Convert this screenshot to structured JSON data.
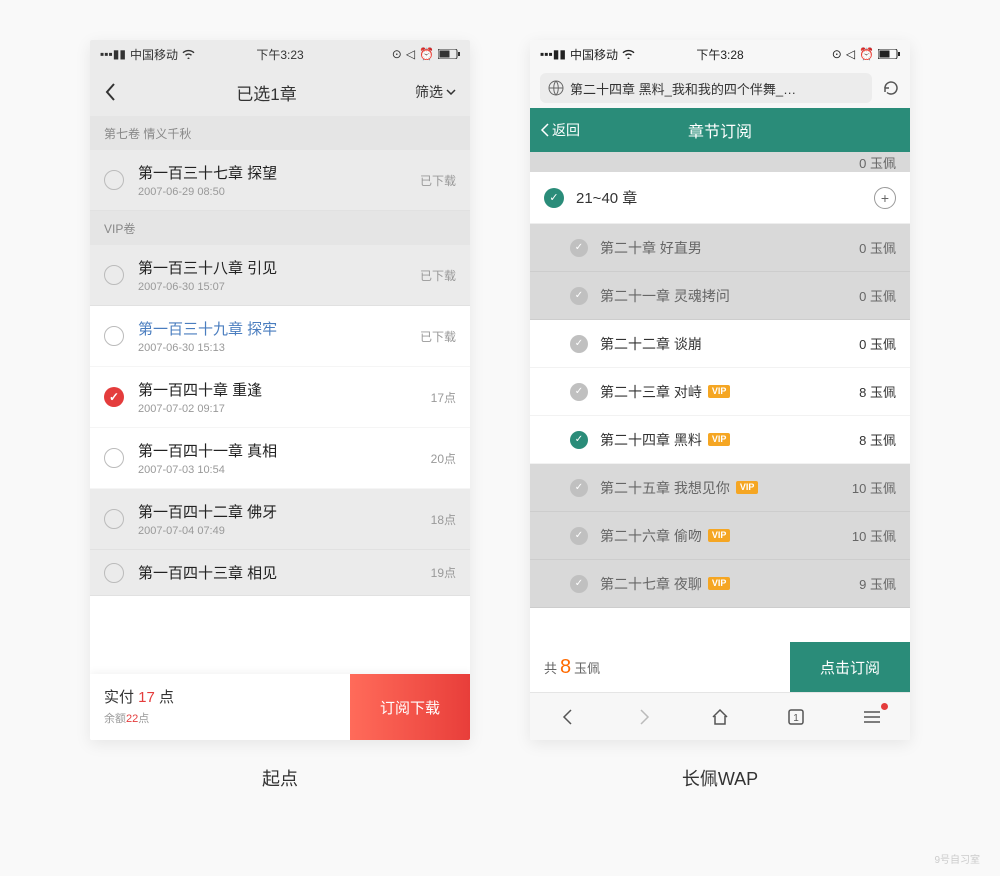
{
  "left": {
    "label": "起点",
    "status": {
      "carrier": "中国移动",
      "time": "下午3:23"
    },
    "header": {
      "title": "已选1章",
      "filter": "筛选"
    },
    "sections": [
      {
        "section_title": "第七卷  情义千秋",
        "items": [
          {
            "title": "第一百三十七章 探望",
            "date": "2007-06-29 08:50",
            "status": "已下载",
            "checked": false,
            "inScope": false,
            "linkblue": false
          }
        ]
      },
      {
        "section_title": "VIP卷",
        "items": [
          {
            "title": "第一百三十八章 引见",
            "date": "2007-06-30 15:07",
            "status": "已下载",
            "checked": false,
            "inScope": false,
            "linkblue": false
          },
          {
            "title": "第一百三十九章 探牢",
            "date": "2007-06-30 15:13",
            "status": "已下载",
            "checked": false,
            "inScope": true,
            "linkblue": true
          },
          {
            "title": "第一百四十章 重逢",
            "date": "2007-07-02 09:17",
            "status": "17点",
            "checked": true,
            "inScope": true,
            "linkblue": false
          },
          {
            "title": "第一百四十一章 真相",
            "date": "2007-07-03 10:54",
            "status": "20点",
            "checked": false,
            "inScope": true,
            "linkblue": false
          },
          {
            "title": "第一百四十二章 佛牙",
            "date": "2007-07-04 07:49",
            "status": "18点",
            "checked": false,
            "inScope": false,
            "linkblue": false
          },
          {
            "title": "第一百四十三章   相见",
            "date": "",
            "status": "19点",
            "checked": false,
            "inScope": false,
            "linkblue": false
          }
        ]
      }
    ],
    "footer": {
      "pay_prefix": "实付 ",
      "pay_amount": "17",
      "pay_suffix": " 点",
      "balance_prefix": "余额",
      "balance_amount": "22",
      "balance_suffix": "点",
      "button": "订阅下载"
    }
  },
  "right": {
    "label": "长佩WAP",
    "status": {
      "carrier": "中国移动",
      "time": "下午3:28"
    },
    "urlbar": "第二十四章 黑料_我和我的四个伴舞_…",
    "header": {
      "back": "返回",
      "title": "章节订阅"
    },
    "partial_top": {
      "left": "",
      "right": "0 玉佩"
    },
    "group": {
      "title": "21~40 章"
    },
    "items": [
      {
        "title": "第二十章 好直男",
        "vip": false,
        "price": "0 玉佩",
        "mode": "dim",
        "checked": "grey"
      },
      {
        "title": "第二十一章 灵魂拷问",
        "vip": false,
        "price": "0 玉佩",
        "mode": "dim",
        "checked": "grey"
      },
      {
        "title": "第二十二章 谈崩",
        "vip": false,
        "price": "0 玉佩",
        "mode": "bright",
        "checked": "grey"
      },
      {
        "title": "第二十三章 对峙",
        "vip": true,
        "price": "8 玉佩",
        "mode": "bright",
        "checked": "grey"
      },
      {
        "title": "第二十四章 黑料",
        "vip": true,
        "price": "8 玉佩",
        "mode": "bright",
        "checked": "green"
      },
      {
        "title": "第二十五章 我想见你",
        "vip": true,
        "price": "10 玉佩",
        "mode": "dim",
        "checked": "grey"
      },
      {
        "title": "第二十六章 偷吻",
        "vip": true,
        "price": "10 玉佩",
        "mode": "dim",
        "checked": "grey"
      },
      {
        "title": "第二十七章 夜聊",
        "vip": true,
        "price": "9 玉佩",
        "mode": "dim",
        "checked": "grey"
      }
    ],
    "footer": {
      "total_prefix": "共 ",
      "total_amount": "8",
      "total_suffix": " 玉佩",
      "button": "点击订阅"
    },
    "vip_label": "VIP"
  },
  "watermark": "9号自习室"
}
